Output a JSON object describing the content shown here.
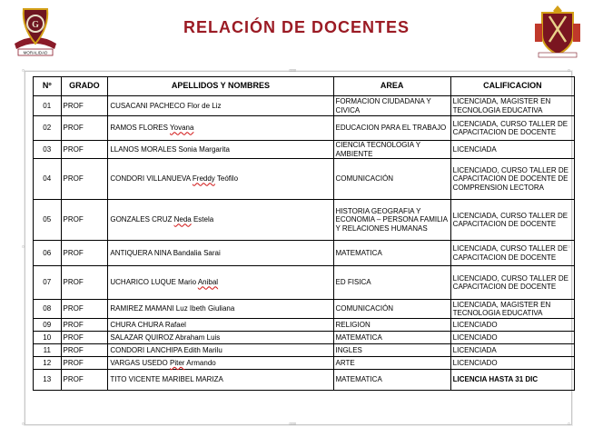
{
  "header": {
    "title": "RELACIÓN DE DOCENTES",
    "left_logo_caption": "MORALIDAD"
  },
  "table": {
    "columns": [
      "Nº",
      "GRADO",
      "APELLIDOS Y NOMBRES",
      "AREA",
      "CALIFICACION"
    ],
    "rows": [
      {
        "n": "01",
        "grado": "PROF",
        "nombre_a": "CUSACANI PACHECO Flor de Liz",
        "nombre_u": "",
        "nombre_b": "",
        "area": "FORMACION CIUDADANA Y CIVICA",
        "calif": "LICENCIADA, MAGISTER EN TECNOLOGIA EDUCATIVA"
      },
      {
        "n": "02",
        "grado": "PROF",
        "nombre_a": "RAMOS FLORES ",
        "nombre_u": "Yovana",
        "nombre_b": "",
        "area": "EDUCACION PARA EL TRABAJO",
        "calif": "LICENCIADA, CURSO TALLER DE CAPACITACION DE DOCENTE"
      },
      {
        "n": "03",
        "grado": "PROF",
        "nombre_a": "LLANOS MORALES Sonia Margarita",
        "nombre_u": "",
        "nombre_b": "",
        "area": "CIENCIA TECNOLOGIA Y AMBIENTE",
        "calif": "LICENCIADA"
      },
      {
        "n": "04",
        "grado": "PROF",
        "nombre_a": "CONDORI VILLANUEVA ",
        "nombre_u": "Freddy",
        "nombre_b": " Teófilo",
        "area": "COMUNICACIÓN",
        "calif": "LICENCIADO, CURSO TALLER DE CAPACITACION DE DOCENTE DE COMPRENSION LECTORA"
      },
      {
        "n": "05",
        "grado": "PROF",
        "nombre_a": "GONZALES CRUZ ",
        "nombre_u": "Neda",
        "nombre_b": " Estela",
        "area": "HISTORIA GEOGRAFIA Y ECONOMIA – PERSONA FAMILIA Y RELACIONES HUMANAS",
        "calif": "LICENCIADA, CURSO TALLER DE CAPACITACION DE DOCENTE"
      },
      {
        "n": "06",
        "grado": "PROF",
        "nombre_a": "ANTIQUERA NINA Bandalia Sarai",
        "nombre_u": "",
        "nombre_b": "",
        "area": "MATEMATICA",
        "calif": "LICENCIADA, CURSO TALLER DE CAPACITACION DE DOCENTE"
      },
      {
        "n": "07",
        "grado": "PROF",
        "nombre_a": "UCHARICO LUQUE Mario ",
        "nombre_u": "Anibal",
        "nombre_b": "",
        "area": "ED FISICA",
        "calif": "LICENCIADO, CURSO TALLER DE CAPACITACION DE DOCENTE"
      },
      {
        "n": "08",
        "grado": "PROF",
        "nombre_a": "RAMIREZ MAMANI Luz Ibeth Giuliana",
        "nombre_u": "",
        "nombre_b": "",
        "area": "COMUNICACIÓN",
        "calif": "LICENCIADA, MAGISTER EN TECNOLOGIA EDUCATIVA"
      },
      {
        "n": "09",
        "grado": "PROF",
        "nombre_a": "CHURA CHURA Rafael",
        "nombre_u": "",
        "nombre_b": "",
        "area": "RELIGION",
        "calif": "LICENCIADO"
      },
      {
        "n": "10",
        "grado": "PROF",
        "nombre_a": "SALAZAR QUIROZ Abraham Luis",
        "nombre_u": "",
        "nombre_b": "",
        "area": "MATEMATICA",
        "calif": "LICENCIADO"
      },
      {
        "n": "11",
        "grado": "PROF",
        "nombre_a": "CONDORI LANCHIPA Edith Marilu",
        "nombre_u": "",
        "nombre_b": "",
        "area": "INGLES",
        "calif": "LICENCIADA"
      },
      {
        "n": "12",
        "grado": "PROF",
        "nombre_a": "VARGAS USEDO ",
        "nombre_u": "Piter",
        "nombre_b": " Armando",
        "area": "ARTE",
        "calif": "LICENCIADO"
      },
      {
        "n": "13",
        "grado": "PROF",
        "nombre_a": "TITO VICENTE MARIBEL MARIZA",
        "nombre_u": "",
        "nombre_b": "",
        "area": "MATEMATICA",
        "calif": "LICENCIA HASTA  31 DIC"
      }
    ]
  },
  "colors": {
    "title": "#9b1b24",
    "crest_dark": "#6e1520",
    "crest_gold": "#d4a017"
  }
}
